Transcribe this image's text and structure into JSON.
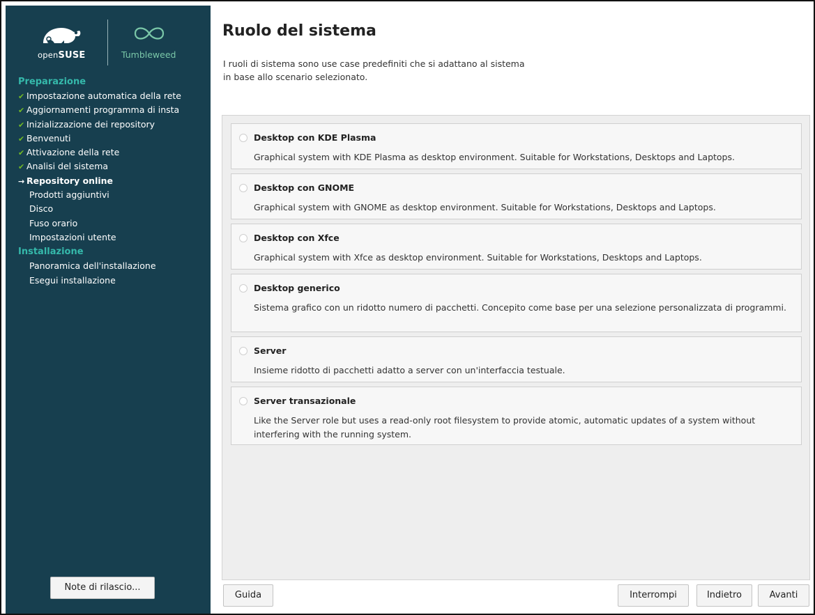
{
  "sidebar": {
    "logo_text_open": "open",
    "logo_text_suse": "SUSE",
    "tumbleweed_text": "Tumbleweed",
    "sections": [
      {
        "title": "Preparazione",
        "steps": [
          {
            "label": "Impostazione automatica della rete",
            "state": "done"
          },
          {
            "label": "Aggiornamenti programma di insta",
            "state": "done"
          },
          {
            "label": "Inizializzazione dei repository",
            "state": "done"
          },
          {
            "label": "Benvenuti",
            "state": "done"
          },
          {
            "label": "Attivazione della rete",
            "state": "done"
          },
          {
            "label": "Analisi del sistema",
            "state": "done"
          },
          {
            "label": "Repository online",
            "state": "current"
          },
          {
            "label": "Prodotti aggiuntivi",
            "state": "todo"
          },
          {
            "label": "Disco",
            "state": "todo"
          },
          {
            "label": "Fuso orario",
            "state": "todo"
          },
          {
            "label": "Impostazioni utente",
            "state": "todo"
          }
        ]
      },
      {
        "title": "Installazione",
        "steps": [
          {
            "label": "Panoramica dell'installazione",
            "state": "todo"
          },
          {
            "label": "Esegui installazione",
            "state": "todo"
          }
        ]
      }
    ],
    "release_notes_button": "Note di rilascio..."
  },
  "main": {
    "title": "Ruolo del sistema",
    "intro": "I ruoli di sistema sono use case predefiniti che si adattano al sistema\nin base allo scenario selezionato.",
    "roles": [
      {
        "title": "Desktop con KDE Plasma",
        "description": "Graphical system with KDE Plasma as desktop environment. Suitable for Workstations, Desktops and Laptops.",
        "selected": false
      },
      {
        "title": "Desktop con GNOME",
        "description": "Graphical system with GNOME as desktop environment. Suitable for Workstations, Desktops and Laptops.",
        "selected": false
      },
      {
        "title": "Desktop con Xfce",
        "description": "Graphical system with Xfce as desktop environment. Suitable for Workstations, Desktops and Laptops.",
        "selected": false
      },
      {
        "title": "Desktop generico",
        "description": "Sistema grafico con un ridotto numero di pacchetti. Concepito come base per una selezione personalizzata di programmi.",
        "selected": false
      },
      {
        "title": "Server",
        "description": "Insieme ridotto di pacchetti adatto a server con un'interfaccia testuale.",
        "selected": false
      },
      {
        "title": "Server transazionale",
        "description": "Like the Server role but uses a read-only root filesystem to provide atomic, automatic updates of a system without interfering with the running system.",
        "selected": false
      }
    ]
  },
  "buttons": {
    "help": "Guida",
    "abort": "Interrompi",
    "back": "Indietro",
    "next": "Avanti"
  },
  "colors": {
    "sidebar_bg": "#173f4f",
    "section_title": "#35b9ab",
    "check": "#73ba25"
  }
}
